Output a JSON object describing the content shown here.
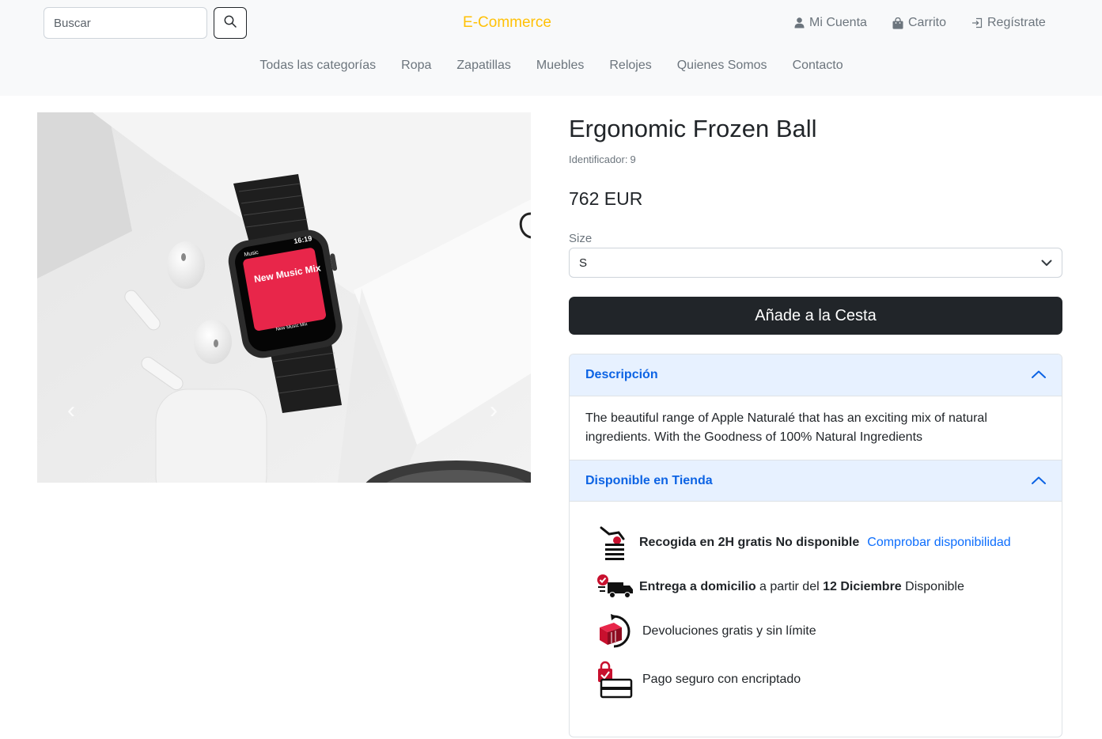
{
  "header": {
    "search_placeholder": "Buscar",
    "brand": "E-Commerce",
    "brand_color": "#ffc107",
    "account_label": "Mi Cuenta",
    "cart_label": "Carrito",
    "register_label": "Regístrate"
  },
  "nav": {
    "items": [
      {
        "label": "Todas las categorías"
      },
      {
        "label": "Ropa"
      },
      {
        "label": "Zapatillas"
      },
      {
        "label": "Muebles"
      },
      {
        "label": "Relojes"
      },
      {
        "label": "Quienes Somos"
      },
      {
        "label": "Contacto"
      }
    ]
  },
  "product": {
    "title": "Ergonomic Frozen Ball",
    "identifier_label": "Identificador:",
    "identifier_value": "9",
    "price": "762 EUR",
    "image": {
      "watch_screen_time": "16:19",
      "watch_screen_app": "Music",
      "watch_screen_title": "New Music Mix",
      "watch_screen_footer": "New Music Mix",
      "accent_color": "#e8264a"
    },
    "size": {
      "label": "Size",
      "selected": "S"
    },
    "add_to_cart_label": "Añade a la Cesta"
  },
  "accordion": {
    "description": {
      "header": "Descripción",
      "text": "The beautiful range of Apple Naturalé that has an exciting mix of natural ingredients. With the Goodness of 100% Natural Ingredients"
    },
    "store": {
      "header": "Disponible en Tienda",
      "pickup": {
        "bold": "Recogida en 2H gratis No disponible",
        "link": "Comprobar disponibilidad"
      },
      "delivery": {
        "bold1": "Entrega a domicilio",
        "text1": "a partir del",
        "bold2": "12 Diciembre",
        "text2": "Disponible"
      },
      "returns": "Devoluciones gratis y sin límite",
      "payment": "Pago seguro con encriptado"
    }
  },
  "colors": {
    "accordion_header_bg": "#e7f1ff",
    "accordion_header_text": "#0c63e4",
    "link": "#0d6efd",
    "button_dark": "#212529",
    "icon_red": "#c8102e"
  }
}
